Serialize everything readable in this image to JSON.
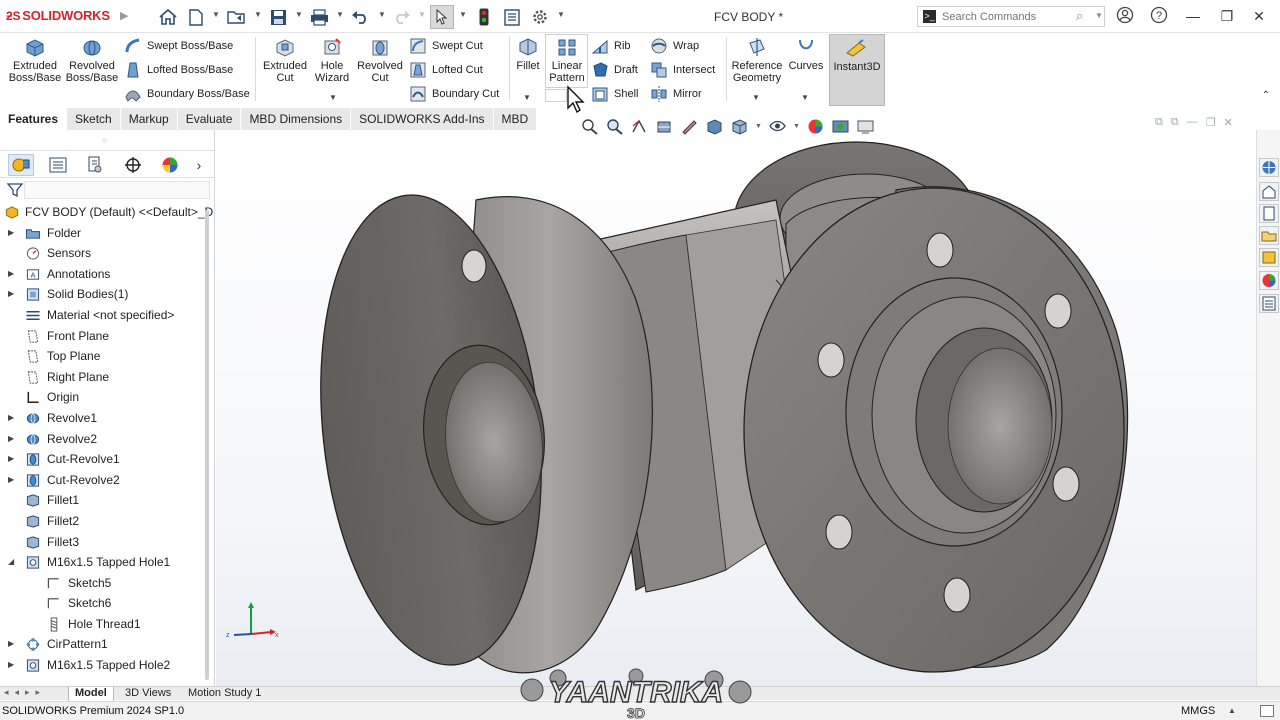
{
  "app": {
    "logo_text": "SOLIDWORKS",
    "document_title": "FCV BODY *"
  },
  "search": {
    "placeholder": "Search Commands"
  },
  "ribbon": {
    "extruded_boss": "Extruded Boss/Base",
    "revolved_boss": "Revolved Boss/Base",
    "swept_boss": "Swept Boss/Base",
    "lofted_boss": "Lofted Boss/Base",
    "boundary_boss": "Boundary Boss/Base",
    "extruded_cut": "Extruded Cut",
    "hole_wizard": "Hole Wizard",
    "revolved_cut": "Revolved Cut",
    "swept_cut": "Swept Cut",
    "lofted_cut": "Lofted Cut",
    "boundary_cut": "Boundary Cut",
    "fillet": "Fillet",
    "linear_pattern": "Linear Pattern",
    "rib": "Rib",
    "draft": "Draft",
    "shell": "Shell",
    "wrap": "Wrap",
    "intersect": "Intersect",
    "mirror": "Mirror",
    "reference_geometry": "Reference Geometry",
    "curves": "Curves",
    "instant3d": "Instant3D"
  },
  "command_tabs": [
    "Features",
    "Sketch",
    "Markup",
    "Evaluate",
    "MBD Dimensions",
    "SOLIDWORKS Add-Ins",
    "MBD"
  ],
  "tree": [
    {
      "label": "FCV BODY (Default) <<Default>_Di",
      "icon": "part-icon",
      "level": 0,
      "expandable": false
    },
    {
      "label": "Folder",
      "icon": "folder-icon",
      "level": 1,
      "expandable": true
    },
    {
      "label": "Sensors",
      "icon": "sensor-icon",
      "level": 1,
      "expandable": false
    },
    {
      "label": "Annotations",
      "icon": "annotation-icon",
      "level": 1,
      "expandable": true
    },
    {
      "label": "Solid Bodies(1)",
      "icon": "solid-bodies-icon",
      "level": 1,
      "expandable": true
    },
    {
      "label": "Material <not specified>",
      "icon": "material-icon",
      "level": 1,
      "expandable": false
    },
    {
      "label": "Front Plane",
      "icon": "plane-icon",
      "level": 1,
      "expandable": false
    },
    {
      "label": "Top Plane",
      "icon": "plane-icon",
      "level": 1,
      "expandable": false
    },
    {
      "label": "Right Plane",
      "icon": "plane-icon",
      "level": 1,
      "expandable": false
    },
    {
      "label": "Origin",
      "icon": "origin-icon",
      "level": 1,
      "expandable": false
    },
    {
      "label": "Revolve1",
      "icon": "revolve-icon",
      "level": 1,
      "expandable": true
    },
    {
      "label": "Revolve2",
      "icon": "revolve-icon",
      "level": 1,
      "expandable": true
    },
    {
      "label": "Cut-Revolve1",
      "icon": "cut-revolve-icon",
      "level": 1,
      "expandable": true
    },
    {
      "label": "Cut-Revolve2",
      "icon": "cut-revolve-icon",
      "level": 1,
      "expandable": true
    },
    {
      "label": "Fillet1",
      "icon": "fillet-icon",
      "level": 1,
      "expandable": false
    },
    {
      "label": "Fillet2",
      "icon": "fillet-icon",
      "level": 1,
      "expandable": false
    },
    {
      "label": "Fillet3",
      "icon": "fillet-icon",
      "level": 1,
      "expandable": false
    },
    {
      "label": "M16x1.5 Tapped Hole1",
      "icon": "hole-icon",
      "level": 1,
      "expandable": true,
      "expanded": true
    },
    {
      "label": "Sketch5",
      "icon": "sketch-icon",
      "level": 2,
      "expandable": false
    },
    {
      "label": "Sketch6",
      "icon": "sketch-icon",
      "level": 2,
      "expandable": false
    },
    {
      "label": "Hole Thread1",
      "icon": "thread-icon",
      "level": 2,
      "expandable": false
    },
    {
      "label": "CirPattern1",
      "icon": "pattern-icon",
      "level": 1,
      "expandable": true
    },
    {
      "label": "M16x1.5 Tapped Hole2",
      "icon": "hole-icon",
      "level": 1,
      "expandable": true
    }
  ],
  "bottom_tabs": [
    "Model",
    "3D Views",
    "Motion Study 1"
  ],
  "status": {
    "product": "SOLIDWORKS Premium 2024 SP1.0",
    "units": "MMGS"
  },
  "watermark": {
    "text": "YAANTRIKA",
    "sub": "3D"
  },
  "colors": {
    "brand_red": "#d2232a",
    "part_gray": "#7a7774",
    "active_tab_bg": "#ffffff",
    "instant3d_bg": "#d4d4d4"
  }
}
